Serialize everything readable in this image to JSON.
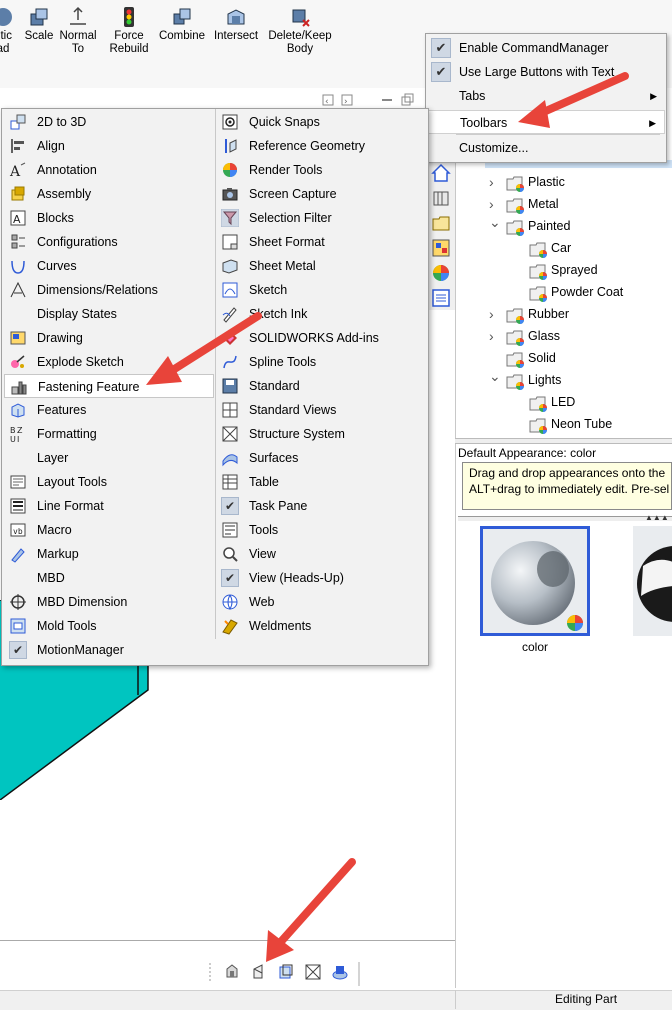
{
  "ribbon": {
    "buttons": [
      {
        "label": "etic\nad",
        "icon": "appearance-icon"
      },
      {
        "label": "Scale",
        "icon": "scale-icon"
      },
      {
        "label": "Normal\nTo",
        "icon": "normal-to-icon"
      },
      {
        "label": "Force\nRebuild",
        "icon": "traffic-light-icon"
      },
      {
        "label": "Combine",
        "icon": "combine-icon"
      },
      {
        "label": "Intersect",
        "icon": "intersect-icon"
      },
      {
        "label": "Delete/Keep\nBody",
        "icon": "delete-body-icon"
      }
    ]
  },
  "context_menu": {
    "items": [
      {
        "label": "Enable CommandManager",
        "checked": true
      },
      {
        "label": "Use Large Buttons with Text",
        "checked": true
      },
      {
        "label": "Tabs",
        "submenu": true
      },
      {
        "label": "Toolbars",
        "submenu": true,
        "highlighted": true
      },
      {
        "label": "Customize..."
      }
    ]
  },
  "toolbars_menu": {
    "left": [
      {
        "label": "2D to 3D",
        "icon": "2d-to-3d-icon"
      },
      {
        "label": "Align",
        "icon": "align-icon"
      },
      {
        "label": "Annotation",
        "icon": "annotation-icon"
      },
      {
        "label": "Assembly",
        "icon": "assembly-icon"
      },
      {
        "label": "Blocks",
        "icon": "blocks-icon"
      },
      {
        "label": "Configurations",
        "icon": "configurations-icon"
      },
      {
        "label": "Curves",
        "icon": "curves-icon"
      },
      {
        "label": "Dimensions/Relations",
        "icon": "dimensions-icon"
      },
      {
        "label": "Display States",
        "icon": ""
      },
      {
        "label": "Drawing",
        "icon": "drawing-icon"
      },
      {
        "label": "Explode Sketch",
        "icon": "explode-sketch-icon"
      },
      {
        "label": "Fastening Feature",
        "icon": "fastening-feature-icon",
        "highlighted": true
      },
      {
        "label": "Features",
        "icon": "features-icon"
      },
      {
        "label": "Formatting",
        "icon": "formatting-icon"
      },
      {
        "label": "Layer",
        "icon": ""
      },
      {
        "label": "Layout Tools",
        "icon": "layout-tools-icon"
      },
      {
        "label": "Line Format",
        "icon": "line-format-icon"
      },
      {
        "label": "Macro",
        "icon": "macro-icon"
      },
      {
        "label": "Markup",
        "icon": "markup-icon"
      },
      {
        "label": "MBD",
        "icon": ""
      },
      {
        "label": "MBD Dimension",
        "icon": "mbd-dimension-icon"
      },
      {
        "label": "Mold Tools",
        "icon": "mold-tools-icon"
      },
      {
        "label": "MotionManager",
        "icon": "check-icon",
        "checked": true
      }
    ],
    "right": [
      {
        "label": "Quick Snaps",
        "icon": "quick-snaps-icon"
      },
      {
        "label": "Reference Geometry",
        "icon": "reference-geometry-icon"
      },
      {
        "label": "Render Tools",
        "icon": "render-tools-icon"
      },
      {
        "label": "Screen Capture",
        "icon": "screen-capture-icon"
      },
      {
        "label": "Selection Filter",
        "icon": "selection-filter-icon"
      },
      {
        "label": "Sheet Format",
        "icon": "sheet-format-icon"
      },
      {
        "label": "Sheet Metal",
        "icon": "sheet-metal-icon"
      },
      {
        "label": "Sketch",
        "icon": "sketch-icon"
      },
      {
        "label": "Sketch Ink",
        "icon": "sketch-ink-icon"
      },
      {
        "label": "SOLIDWORKS Add-ins",
        "icon": "add-ins-icon"
      },
      {
        "label": "Spline Tools",
        "icon": "spline-tools-icon"
      },
      {
        "label": "Standard",
        "icon": "standard-icon"
      },
      {
        "label": "Standard Views",
        "icon": "standard-views-icon"
      },
      {
        "label": "Structure System",
        "icon": "structure-system-icon"
      },
      {
        "label": "Surfaces",
        "icon": "surfaces-icon"
      },
      {
        "label": "Table",
        "icon": "table-icon"
      },
      {
        "label": "Task Pane",
        "icon": "check-icon",
        "checked": true
      },
      {
        "label": "Tools",
        "icon": "tools-icon"
      },
      {
        "label": "View",
        "icon": "view-icon"
      },
      {
        "label": "View (Heads-Up)",
        "icon": "check-icon",
        "checked": true
      },
      {
        "label": "Web",
        "icon": "web-icon"
      },
      {
        "label": "Weldments",
        "icon": "weldments-icon"
      }
    ]
  },
  "task_pane": {
    "tree": [
      {
        "label": "Plastic",
        "level": 1,
        "expander": "collapsed"
      },
      {
        "label": "Metal",
        "level": 1,
        "expander": "collapsed"
      },
      {
        "label": "Painted",
        "level": 1,
        "expander": "expanded"
      },
      {
        "label": "Car",
        "level": 2
      },
      {
        "label": "Sprayed",
        "level": 2
      },
      {
        "label": "Powder Coat",
        "level": 2
      },
      {
        "label": "Rubber",
        "level": 1,
        "expander": "collapsed"
      },
      {
        "label": "Glass",
        "level": 1,
        "expander": "collapsed"
      },
      {
        "label": "Solid",
        "level": 1
      },
      {
        "label": "Lights",
        "level": 1,
        "expander": "expanded"
      },
      {
        "label": "LED",
        "level": 2
      },
      {
        "label": "Neon Tube",
        "level": 2
      }
    ],
    "appearance_label": "Default Appearance: color",
    "tooltip_lines": [
      "Drag and drop appearances onto the",
      "ALT+drag to immediately edit.  Pre-sel"
    ],
    "swatch_label": "color"
  },
  "status": {
    "text": "Editing Part"
  },
  "colors": {
    "accent": "#2f5bd7",
    "arrow": "#e8443a",
    "model": "#00c5c0",
    "tooltip_bg": "#ffffe1"
  }
}
